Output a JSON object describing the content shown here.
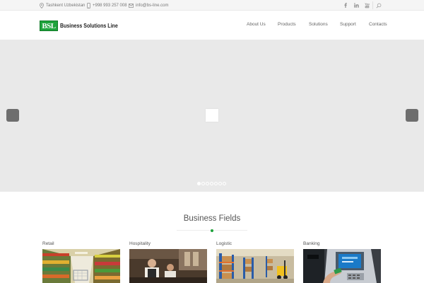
{
  "topbar": {
    "location": "Tashkent Uzbekistan",
    "phone": "+998 993 257 008",
    "email": "info@bs-line.com",
    "social": [
      "facebook-icon",
      "linkedin-icon",
      "youtube-icon"
    ],
    "search_icon": "search-icon"
  },
  "header": {
    "logo_mark": "BSL",
    "logo_text": "Business Solutions Line",
    "nav": [
      "About Us",
      "Products",
      "Solutions",
      "Support",
      "Contacts"
    ]
  },
  "slider": {
    "slide_count": 7,
    "active_slide": 1
  },
  "section": {
    "title": "Business Fields",
    "cards": [
      "Retail",
      "Hospitality",
      "Logistic",
      "Banking"
    ]
  },
  "colors": {
    "brand_green": "#1fa33c",
    "slider_bg": "#e9e9e9",
    "arrow_bg": "#6e6e6e"
  }
}
